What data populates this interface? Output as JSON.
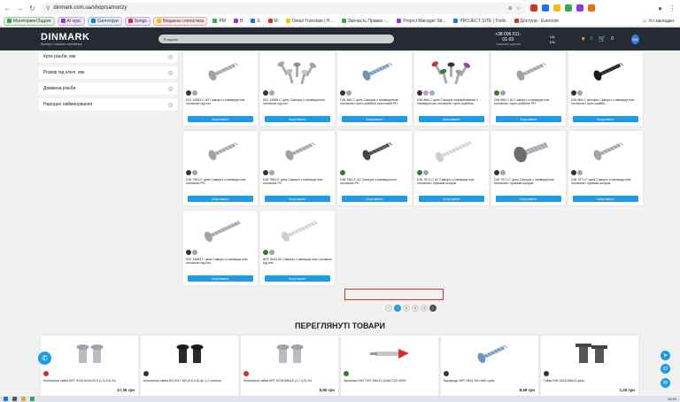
{
  "browser": {
    "url": "dinmark.com.ua/shop/samorizy",
    "extensions": [
      "#d93025",
      "#1a73e8",
      "#fbbc04",
      "#34a853",
      "#9334e6",
      "#e8710a"
    ]
  },
  "bookmarks": {
    "items": [
      {
        "label": "Моніторинг/Задачі",
        "style": "green"
      },
      {
        "label": "AI курс",
        "style": "purple"
      },
      {
        "label": "Синтегруи",
        "style": "blue"
      },
      {
        "label": "Songs",
        "style": "purple"
      },
      {
        "label": "Бёданна статистика",
        "style": "red"
      },
      {
        "label": "PM",
        "style": "plain"
      },
      {
        "label": "B",
        "style": "plain"
      },
      {
        "label": "S",
        "style": "plain"
      },
      {
        "label": "M",
        "style": "plain"
      },
      {
        "label": "Deepl Translate | H...",
        "style": "plain"
      },
      {
        "label": "Запчасть Правки -...",
        "style": "plain"
      },
      {
        "label": "Project Manager Sit...",
        "style": "plain"
      },
      {
        "label": "PROJECT SITE | Trello",
        "style": "plain"
      },
      {
        "label": "Доступи - Evernote",
        "style": "plain"
      }
    ],
    "all_bookmarks": "Усі закладки"
  },
  "header": {
    "logo_name": "DINMARK",
    "logo_tagline": "Експерт з якісного кріплення",
    "search_placeholder": "Я шукаю",
    "phone": "+38 096 011-01-03",
    "phone_sub": "Замовити дзвінок",
    "lang_top": "UA",
    "lang_bottom": "EN",
    "wishlist_count": "0",
    "cart_count": "0",
    "avatar_text": "DM"
  },
  "filters": [
    "Крок різьби, мм",
    "Розмір під ключ, мм",
    "Довжина різьби",
    "Народне найменування"
  ],
  "products": [
    {
      "title": "ISO 14583-C A4 Саморіз з напівкруглою головкою під torx",
      "badges": [
        "#333",
        "#9aa"
      ],
      "shape": "screw-pan-silver"
    },
    {
      "title": "ISO 14585-C цинк Саморіз з напівкруглою головкою під torx",
      "badges": [
        "#333",
        "#9aa"
      ],
      "shape": "screws-pile"
    },
    {
      "title": "DIN 968-C цинк Саморіз з напівкруглою головкою і прес-шайбою хрестовий PH",
      "badges": [
        "#333",
        "#9aa"
      ],
      "shape": "screw-blue"
    },
    {
      "title": "DIN 968-C цинк Саморіз пофарбований з напівкруглою головкою і прес-шайбою",
      "badges": [
        "#333",
        "#c9a",
        "#9ac"
      ],
      "shape": "screws-color"
    },
    {
      "title": "DIN 968-C A2 Саморіз з напівкруглою головкою і прес-шайбою PH",
      "badges": [
        "#2e7d32",
        "#9aa"
      ],
      "shape": "screw-pan-silver"
    },
    {
      "title": "DIN 968-C фосфат Саморіз з напівкруглою головкою і прес-шайбо...",
      "badges": [
        "#333",
        "#9aa"
      ],
      "shape": "screw-black"
    },
    {
      "title": "DIN 7981-F цинк Саморіз з напівкруглою головкою PH",
      "badges": [
        "#333",
        "#9aa"
      ],
      "shape": "screw-pan-silver"
    },
    {
      "title": "DIN 7981-F цинк Саморіз з напівкруглою головкою PZ",
      "badges": [
        "#333",
        "#9aa"
      ],
      "shape": "screw-pan-silver"
    },
    {
      "title": "DIN 7981-F A2 Саморіз з напівкруглою головкою PH",
      "badges": [
        "#2e7d32"
      ],
      "shape": "screw-dark"
    },
    {
      "title": "DIN 7971-C A2 Саморіз з напівкруглою головкою і прямим шліцом",
      "badges": [
        "#2e7d32",
        "#9aa"
      ],
      "shape": "screw-long-white"
    },
    {
      "title": "DIN 7971-C цинк Саморіз з напівкруглою головкою і прямим шліцом",
      "badges": [
        "#333",
        "#9aa"
      ],
      "shape": "screw-big-pan"
    },
    {
      "title": "DIN 7971-F цинк Саморіз з напівкруглою головкою і прямим шліцом",
      "badges": [
        "#333",
        "#9aa"
      ],
      "shape": "screw-pan-silver"
    },
    {
      "title": "ISO 14583-F цинк Саморіз з напівкруглою головкою під torx",
      "badges": [
        "#333",
        "#9aa"
      ],
      "shape": "screw-long-silver"
    },
    {
      "title": "ART 9043 A2 Саморіз з напівкруглою головкою під torx",
      "badges": [
        "#2e7d32",
        "#9aa"
      ],
      "shape": "screw-long-white"
    }
  ],
  "buy_label": "Асортимент",
  "pagination": {
    "prev": "‹",
    "pages": [
      "1",
      "2",
      "3",
      "4"
    ],
    "active": "1",
    "next": "›"
  },
  "viewed": {
    "title": "ПЕРЕГЛЯНУТІ ТОВАРИ",
    "items": [
      {
        "title": "Клепальна гайка ART 9218 М10х20,5 (1,5-4,0) А4",
        "price": "17,36 грн",
        "badge": "#d32f2f",
        "shape": "rivet-nut"
      },
      {
        "title": "Клепальна гайка ЕN 9117 М3 (0,5-4,0) ф/ 1,2 конічна",
        "price": "",
        "badge": "#333",
        "shape": "rivet-nut-black"
      },
      {
        "title": "Клепальна гайка ART 9218 М6х15 (1,7-4,0) А4",
        "price": "5,90 грн",
        "badge": "#d32f2f",
        "shape": "rivet-nut-small"
      },
      {
        "title": "Заклепка DIN 7337 М4х12 А2/А2 ISO 9005",
        "price": "",
        "badge": "#2e7d32",
        "shape": "rivet"
      },
      {
        "title": "Бурфундт ART 9491 М4 ha50 цинк",
        "price": "8,59 грн",
        "badge": "#333",
        "shape": "screw-blue"
      },
      {
        "title": "Гайка DIN 1624 М6х11 цинк",
        "price": "1,20 грн",
        "badge": "#333",
        "shape": "tee-nut"
      }
    ]
  },
  "fab": {
    "phone_icon": "phone-icon",
    "telegram_icon": "telegram-icon",
    "scroll_icon": "chevron-up-icon"
  },
  "taskbar": {
    "time": "10:29"
  }
}
